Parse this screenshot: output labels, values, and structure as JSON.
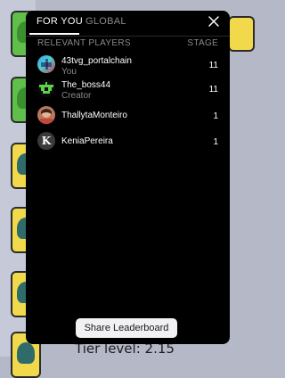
{
  "tabs": [
    {
      "label": "FOR YOU",
      "active": true
    },
    {
      "label": "GLOBAL",
      "active": false
    }
  ],
  "header": {
    "left": "RELEVANT PLAYERS",
    "right": "STAGE"
  },
  "players": [
    {
      "name": "43tvg_portalchain",
      "subtitle": "You",
      "stage": "11",
      "avatar": "gradient-avatar"
    },
    {
      "name": "The_boss44",
      "subtitle": "Creator",
      "stage": "11",
      "avatar": "pixel-avatar"
    },
    {
      "name": "ThallytaMonteiro",
      "subtitle": "",
      "stage": "1",
      "avatar": "photo-avatar"
    },
    {
      "name": "KeniaPereira",
      "subtitle": "",
      "stage": "1",
      "avatar": "letter-avatar",
      "initial": "K"
    }
  ],
  "share_button": "Share Leaderboard",
  "background": {
    "tier_text": "Tier level: 2.15"
  },
  "colors": {
    "panel": "#000000",
    "muted": "#8a8a8a",
    "button": "#f1f1f4"
  }
}
